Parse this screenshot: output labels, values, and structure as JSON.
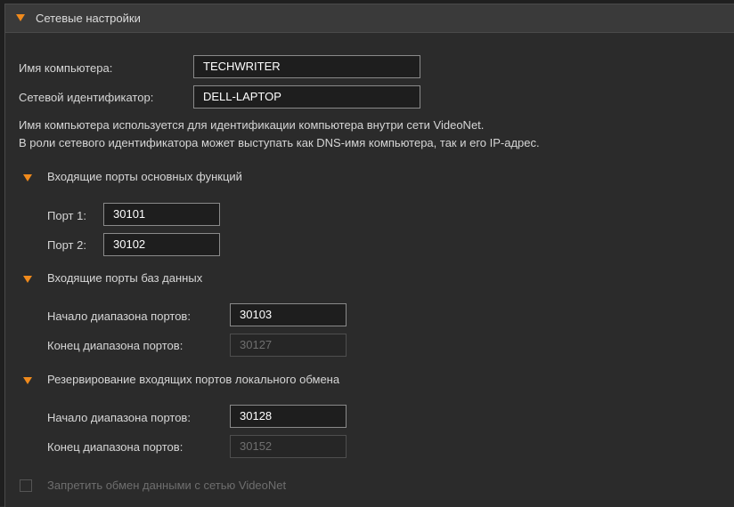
{
  "header": {
    "title": "Сетевые настройки"
  },
  "computer": {
    "name_label": "Имя компьютера:",
    "name_value": "TECHWRITER",
    "netid_label": "Сетевой идентификатор:",
    "netid_value": "DELL-LAPTOP",
    "desc_line1": "Имя компьютера используется для идентификации компьютера внутри сети VideoNet.",
    "desc_line2": "В роли сетевого идентификатора может выступать как DNS-имя компьютера, так и его IP-адрес."
  },
  "main_ports": {
    "title": "Входящие порты основных функций",
    "port1_label": "Порт 1:",
    "port1_value": "30101",
    "port2_label": "Порт 2:",
    "port2_value": "30102"
  },
  "db_ports": {
    "title": "Входящие порты баз данных",
    "start_label": "Начало диапазона портов:",
    "start_value": "30103",
    "end_label": "Конец диапазона портов:",
    "end_value": "30127"
  },
  "local_ports": {
    "title": "Резервирование входящих портов локального обмена",
    "start_label": "Начало диапазона портов:",
    "start_value": "30128",
    "end_label": "Конец диапазона портов:",
    "end_value": "30152"
  },
  "disable_checkbox": {
    "label": "Запретить обмен данными с сетью VideoNet",
    "checked": false
  },
  "colors": {
    "accent": "#f08a1c",
    "background": "#2b2b2b",
    "field_bg": "#1e1e1e"
  }
}
